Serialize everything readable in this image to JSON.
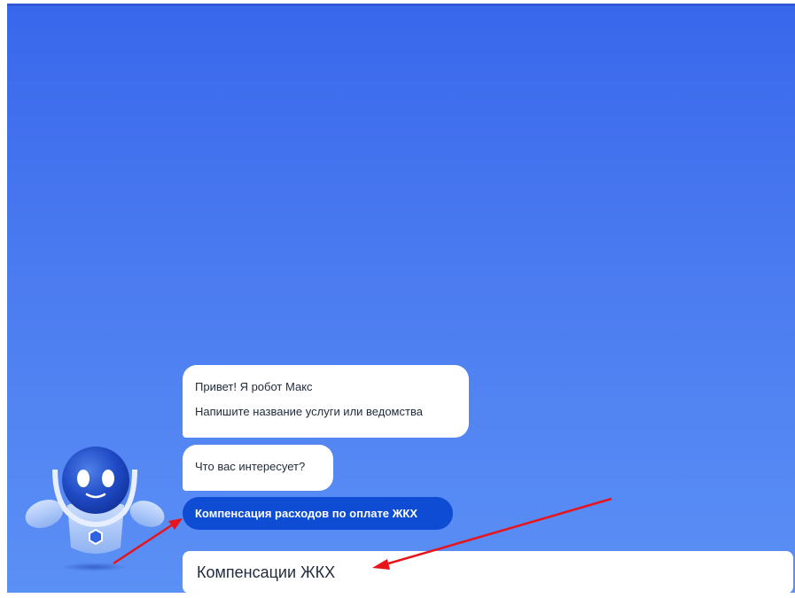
{
  "chat": {
    "greeting_line1": "Привет! Я робот Макс",
    "greeting_line2": "Напишите название услуги или ведомства",
    "question": "Что вас интересует?",
    "suggestion": "Компенсация расходов по оплате ЖКХ"
  },
  "input": {
    "value": "Компенсации ЖКХ"
  },
  "colors": {
    "accent": "#0d4cd3",
    "background_top": "#3967ec",
    "background_bottom": "#5b90f5",
    "annotation_arrow": "#e8141b"
  },
  "icons": {
    "assistant": "robot-max-icon"
  }
}
